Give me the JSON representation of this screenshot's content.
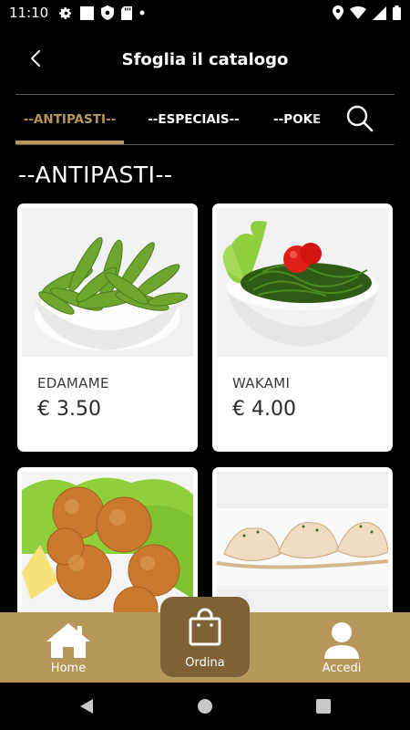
{
  "status_bar": {
    "time": "11:10",
    "left_icons": [
      "settings-icon",
      "white-square-icon",
      "shield-icon",
      "sd-card-icon",
      "dot-icon"
    ],
    "right_icons": [
      "location-icon",
      "wifi-icon",
      "signal-icon",
      "battery-icon"
    ]
  },
  "header": {
    "title": "Sfoglia il catalogo",
    "back_icon": "chevron-left-icon"
  },
  "tabs": [
    {
      "label": "--ANTIPASTI--",
      "active": true
    },
    {
      "label": "--ESPECIAIS--",
      "active": false
    },
    {
      "label": "--POKE",
      "active": false
    }
  ],
  "search": {
    "icon": "search-icon"
  },
  "section": {
    "title": "--ANTIPASTI--"
  },
  "products": [
    {
      "name": "EDAMAME",
      "price": "€ 3.50",
      "image": "edamame-photo"
    },
    {
      "name": "WAKAMI",
      "price": "€ 4.00",
      "image": "wakame-salad-photo"
    },
    {
      "name": "",
      "price": "",
      "image": "fried-balls-photo"
    },
    {
      "name": "",
      "price": "",
      "image": "gyoza-photo"
    }
  ],
  "bottom_nav": {
    "home": {
      "label": "Home",
      "icon": "home-icon"
    },
    "order": {
      "label": "Ordina",
      "icon": "shopping-bag-icon"
    },
    "login": {
      "label": "Accedi",
      "icon": "user-icon"
    }
  },
  "colors": {
    "accent": "#b8975c",
    "order_button": "#7e6135",
    "background": "#000000",
    "card": "#ffffff"
  }
}
